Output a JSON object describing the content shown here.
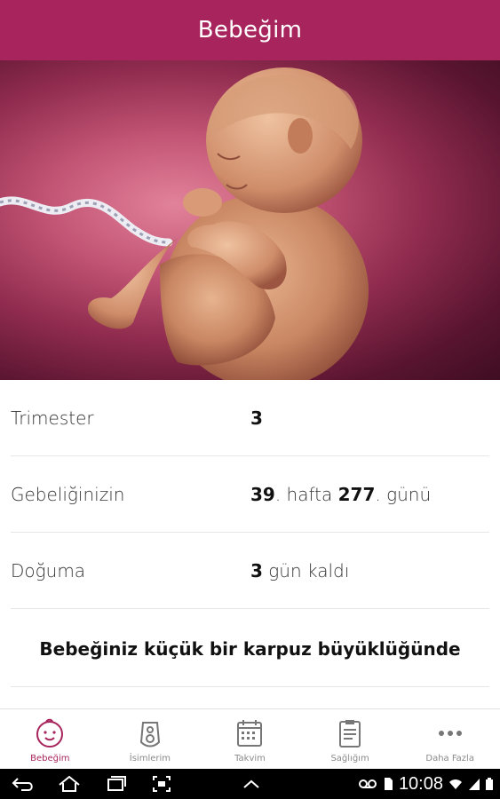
{
  "app": {
    "title": "Bebeğim"
  },
  "info": {
    "trimester": {
      "label": "Trimester",
      "value": "3"
    },
    "pregnancy": {
      "label": "Gebeliğinizin",
      "week_value": "39",
      "week_text": ". hafta ",
      "day_value": "277",
      "day_text": ". günü"
    },
    "due": {
      "label": "Doğuma",
      "days_value": "3",
      "days_text": " gün kaldı"
    }
  },
  "size_text": "Bebeğiniz küçük bir karpuz büyüklüğünde",
  "tabs": [
    {
      "label": "Bebeğim",
      "icon": "baby-face-icon",
      "active": true
    },
    {
      "label": "İsimlerim",
      "icon": "name-tag-icon",
      "active": false
    },
    {
      "label": "Takvim",
      "icon": "calendar-icon",
      "active": false
    },
    {
      "label": "Sağlığım",
      "icon": "clipboard-icon",
      "active": false
    },
    {
      "label": "Daha Fazla",
      "icon": "more-icon",
      "active": false
    }
  ],
  "status": {
    "time": "10:08"
  },
  "colors": {
    "accent": "#a8245c"
  }
}
